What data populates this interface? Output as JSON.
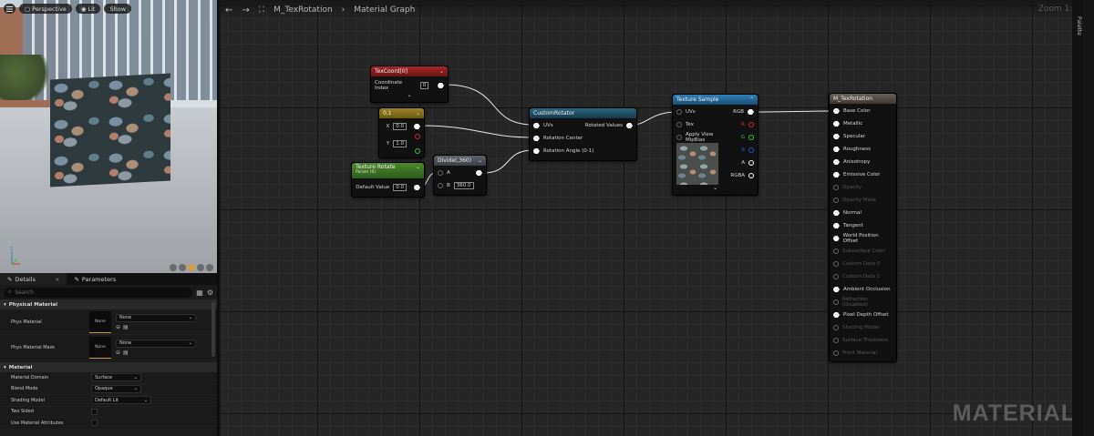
{
  "viewport": {
    "menu_icon": "hamburger-menu-icon",
    "perspective_label": "Perspective",
    "lit_label": "Lit",
    "show_label": "Show"
  },
  "details": {
    "tabs": [
      {
        "label": "Details"
      },
      {
        "label": "Parameters"
      }
    ],
    "search_placeholder": "Search",
    "sections": {
      "physical_material": "Physical Material",
      "material": "Material"
    },
    "phys_material": {
      "label": "Phys Material",
      "thumb": "None",
      "value": "None"
    },
    "phys_material_mask": {
      "label": "Phys Material Mask",
      "thumb": "None",
      "value": "None"
    },
    "props": [
      {
        "label": "Material Domain",
        "value": "Surface"
      },
      {
        "label": "Blend Mode",
        "value": "Opaque"
      },
      {
        "label": "Shading Model",
        "value": "Default Lit"
      },
      {
        "label": "Two Sided",
        "value": ""
      },
      {
        "label": "Use Material Attributes",
        "value": ""
      }
    ]
  },
  "graph": {
    "breadcrumb_asset": "M_TexRotation",
    "breadcrumb_sep": "›",
    "breadcrumb_graph": "Material Graph",
    "zoom": "Zoom 1:1",
    "watermark": "MATERIAL",
    "palette_label": "Palette"
  },
  "nodes": {
    "texcoord": {
      "title": "TexCoord[0]",
      "pin_label": "Coordinate Index",
      "value": "0",
      "color": "#8e1b1b"
    },
    "const2": {
      "title": "0,1",
      "x_label": "X",
      "x_value": "0.0",
      "y_label": "Y",
      "y_value": "1.0",
      "color": "#8b7516"
    },
    "texrotate": {
      "title": "Texture Rotate",
      "subtitle": "Param (0)",
      "pin_label": "Default Value",
      "value": "0.0",
      "color": "#3b6e23"
    },
    "divide": {
      "title": "Divide(,360)",
      "a_label": "A",
      "b_label": "B",
      "b_value": "360.0",
      "color": "#4a5056"
    },
    "custom": {
      "title": "CustomRotator",
      "inputs": [
        "UVs",
        "Rotation Center",
        "Rotation Angle (0-1)"
      ],
      "output": "Rotated Values",
      "color": "#1f4f62"
    },
    "texsample": {
      "title": "Texture Sample",
      "inputs": [
        "UVs",
        "Tex",
        "Apply View MipBias"
      ],
      "outputs": [
        "RGB",
        "R",
        "G",
        "B",
        "A",
        "RGBA"
      ],
      "color": "#1c5d8a"
    },
    "result": {
      "title": "M_TexRotation",
      "color": "#5a5249",
      "pins": [
        {
          "label": "Base Color",
          "active": true
        },
        {
          "label": "Metallic",
          "active": true
        },
        {
          "label": "Specular",
          "active": true
        },
        {
          "label": "Roughness",
          "active": true
        },
        {
          "label": "Anisotropy",
          "active": true
        },
        {
          "label": "Emissive Color",
          "active": true
        },
        {
          "label": "Opacity",
          "active": false
        },
        {
          "label": "Opacity Mask",
          "active": false
        },
        {
          "label": "Normal",
          "active": true
        },
        {
          "label": "Tangent",
          "active": true
        },
        {
          "label": "World Position Offset",
          "active": true
        },
        {
          "label": "Subsurface Color",
          "active": false
        },
        {
          "label": "Custom Data 0",
          "active": false
        },
        {
          "label": "Custom Data 1",
          "active": false
        },
        {
          "label": "Ambient Occlusion",
          "active": true
        },
        {
          "label": "Refraction (Disabled)",
          "active": false
        },
        {
          "label": "Pixel Depth Offset",
          "active": true
        },
        {
          "label": "Shading Model",
          "active": false
        },
        {
          "label": "Surface Thickness",
          "active": false
        },
        {
          "label": "Front Material",
          "active": false
        }
      ]
    }
  }
}
